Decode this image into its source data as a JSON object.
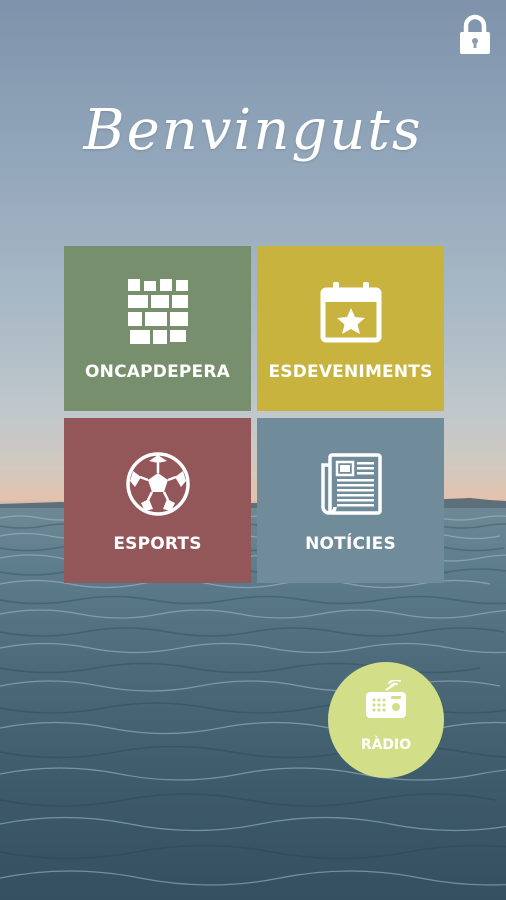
{
  "header": {
    "lock_icon": "lock-icon",
    "title": "Benvinguts"
  },
  "menu": {
    "tiles": [
      {
        "label": "ONCAPDEPERA",
        "icon": "castle-wall-icon",
        "color": "#788f6e"
      },
      {
        "label": "ESDEVENIMENTS",
        "icon": "calendar-star-icon",
        "color": "#c8b33f"
      },
      {
        "label": "ESPORTS",
        "icon": "soccer-ball-icon",
        "color": "#935659"
      },
      {
        "label": "NOTÍCIES",
        "icon": "newspaper-icon",
        "color": "#708b9a"
      }
    ]
  },
  "radio": {
    "label": "RÀDIO",
    "icon": "radio-icon",
    "color": "#d3df88"
  },
  "colors": {
    "text": "#ffffff"
  }
}
